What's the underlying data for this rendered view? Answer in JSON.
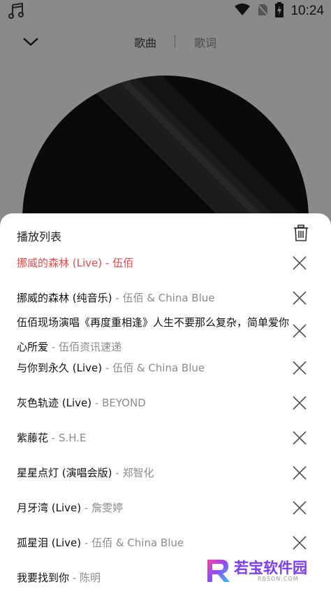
{
  "statusbar": {
    "time": "10:24",
    "icons": [
      "music-note-icon",
      "wifi-icon",
      "no-sim-icon",
      "battery-charging-icon"
    ]
  },
  "header": {
    "back_icon": "chevron-down-icon",
    "tab_song": "歌曲",
    "tab_lyrics": "歌词"
  },
  "playlist": {
    "title": "播放列表",
    "clear_icon": "trash-icon",
    "items": [
      {
        "title": "挪威的森林 (Live)",
        "sep": " - ",
        "artist": "伍佰",
        "playing": true
      },
      {
        "title": "挪威的森林 (纯音乐)",
        "sep": " - ",
        "artist": "伍佰 & China Blue"
      },
      {
        "title": "伍佰现场演唱《再度重相逢》人生不要那么复杂，简单爱你心所爱",
        "sep": " - ",
        "artist": "伍佰资讯速递"
      },
      {
        "title": "与你到永久 (Live)",
        "sep": " - ",
        "artist": "伍佰 & China Blue"
      },
      {
        "title": "灰色轨迹 (Live)",
        "sep": " - ",
        "artist": "BEYOND"
      },
      {
        "title": "紫藤花",
        "sep": " - ",
        "artist": "S.H.E"
      },
      {
        "title": "星星点灯 (演唱会版)",
        "sep": " - ",
        "artist": "郑智化"
      },
      {
        "title": "月牙湾 (Live)",
        "sep": " - ",
        "artist": "詹雯婷"
      },
      {
        "title": "孤星泪 (Live)",
        "sep": " - ",
        "artist": "伍佰 & China Blue"
      },
      {
        "title": "我要找到你",
        "sep": " - ",
        "artist": "陈明"
      }
    ]
  },
  "watermark": {
    "title": "若宝软件园",
    "subtitle": "RBSON.COM"
  }
}
